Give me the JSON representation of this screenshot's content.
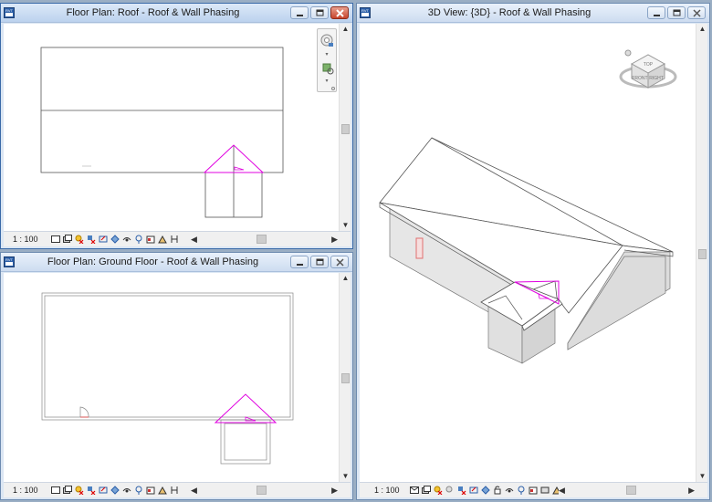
{
  "windows": {
    "roof_plan": {
      "title": "Floor Plan: Roof - Roof & Wall Phasing",
      "scale": "1 : 100"
    },
    "ground_plan": {
      "title": "Floor Plan: Ground Floor - Roof & Wall Phasing",
      "scale": "1 : 100"
    },
    "view_3d": {
      "title": "3D View: {3D} - Roof & Wall Phasing",
      "scale": "1 : 100"
    }
  },
  "viewcube": {
    "front": "FRONT",
    "right": "RIGHT",
    "top": "TOP"
  },
  "colors": {
    "highlight": "#e000e0",
    "door": "#e07070",
    "wall_shade": "#e4e4e4"
  }
}
